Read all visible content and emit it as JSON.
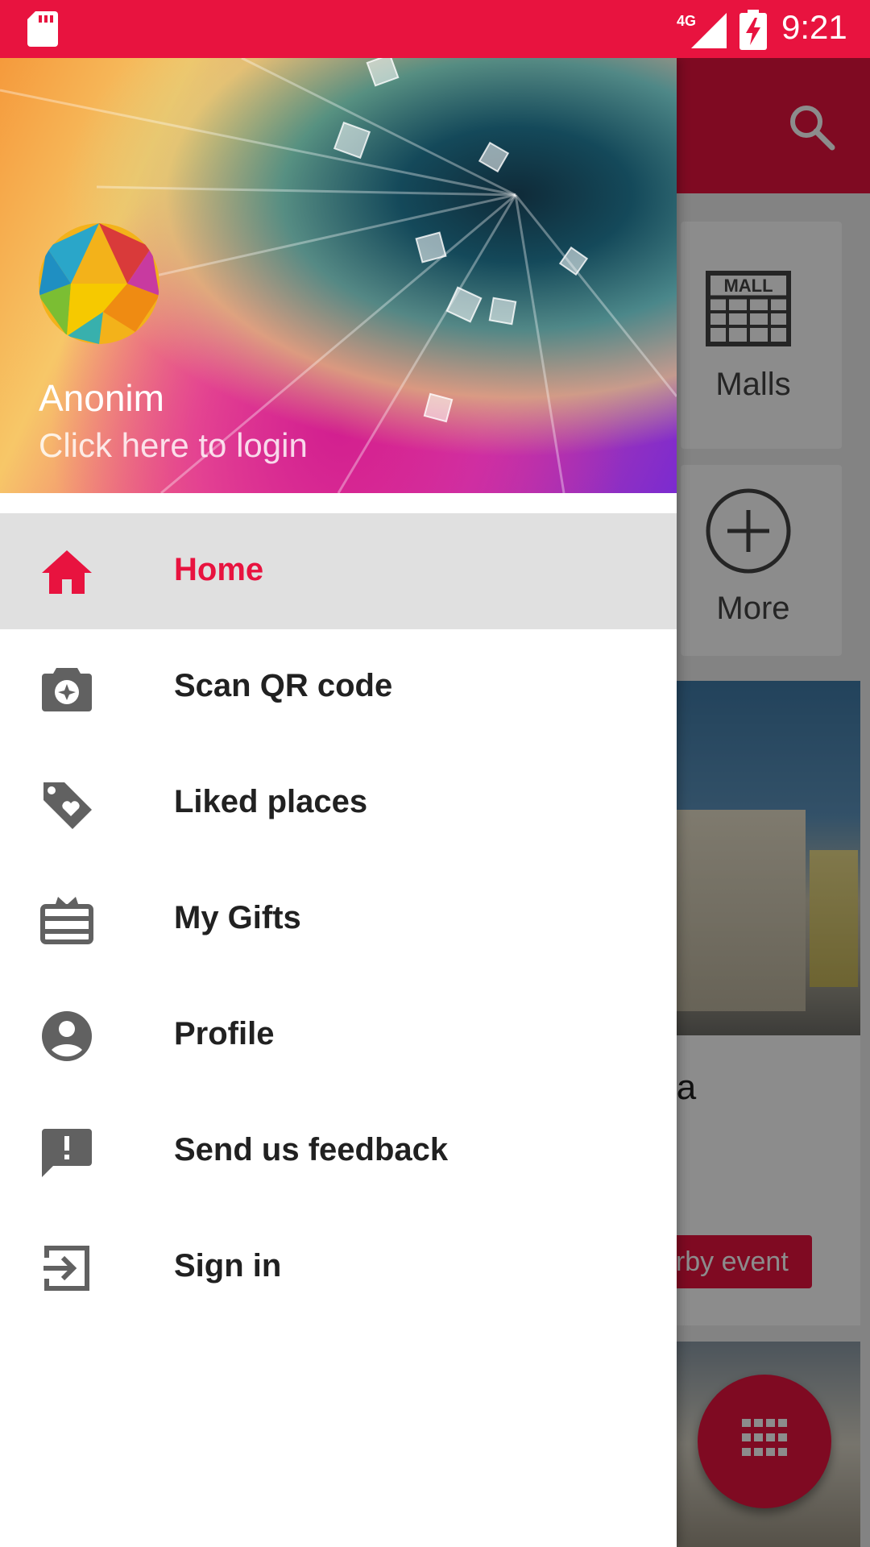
{
  "status_bar": {
    "network": "4G",
    "time": "9:21"
  },
  "drawer": {
    "header": {
      "user_name": "Anonim",
      "login_prompt": "Click here to login"
    },
    "items": [
      {
        "label": "Home",
        "icon": "home-icon",
        "active": true
      },
      {
        "label": "Scan QR code",
        "icon": "camera-icon",
        "active": false
      },
      {
        "label": "Liked places",
        "icon": "tag-heart-icon",
        "active": false
      },
      {
        "label": "My Gifts",
        "icon": "gift-card-icon",
        "active": false
      },
      {
        "label": "Profile",
        "icon": "account-circle-icon",
        "active": false
      },
      {
        "label": "Send us feedback",
        "icon": "feedback-icon",
        "active": false
      },
      {
        "label": "Sign in",
        "icon": "sign-in-icon",
        "active": false
      }
    ]
  },
  "background": {
    "tiles": [
      {
        "label": "Malls",
        "icon": "mall-icon"
      },
      {
        "label": "More",
        "icon": "plus-circle-icon"
      }
    ],
    "card_title_fragment": "ia",
    "nearby_button_fragment": "arby event"
  },
  "colors": {
    "accent": "#e8133f",
    "active_row": "#e0e0e0",
    "text": "#212121"
  }
}
